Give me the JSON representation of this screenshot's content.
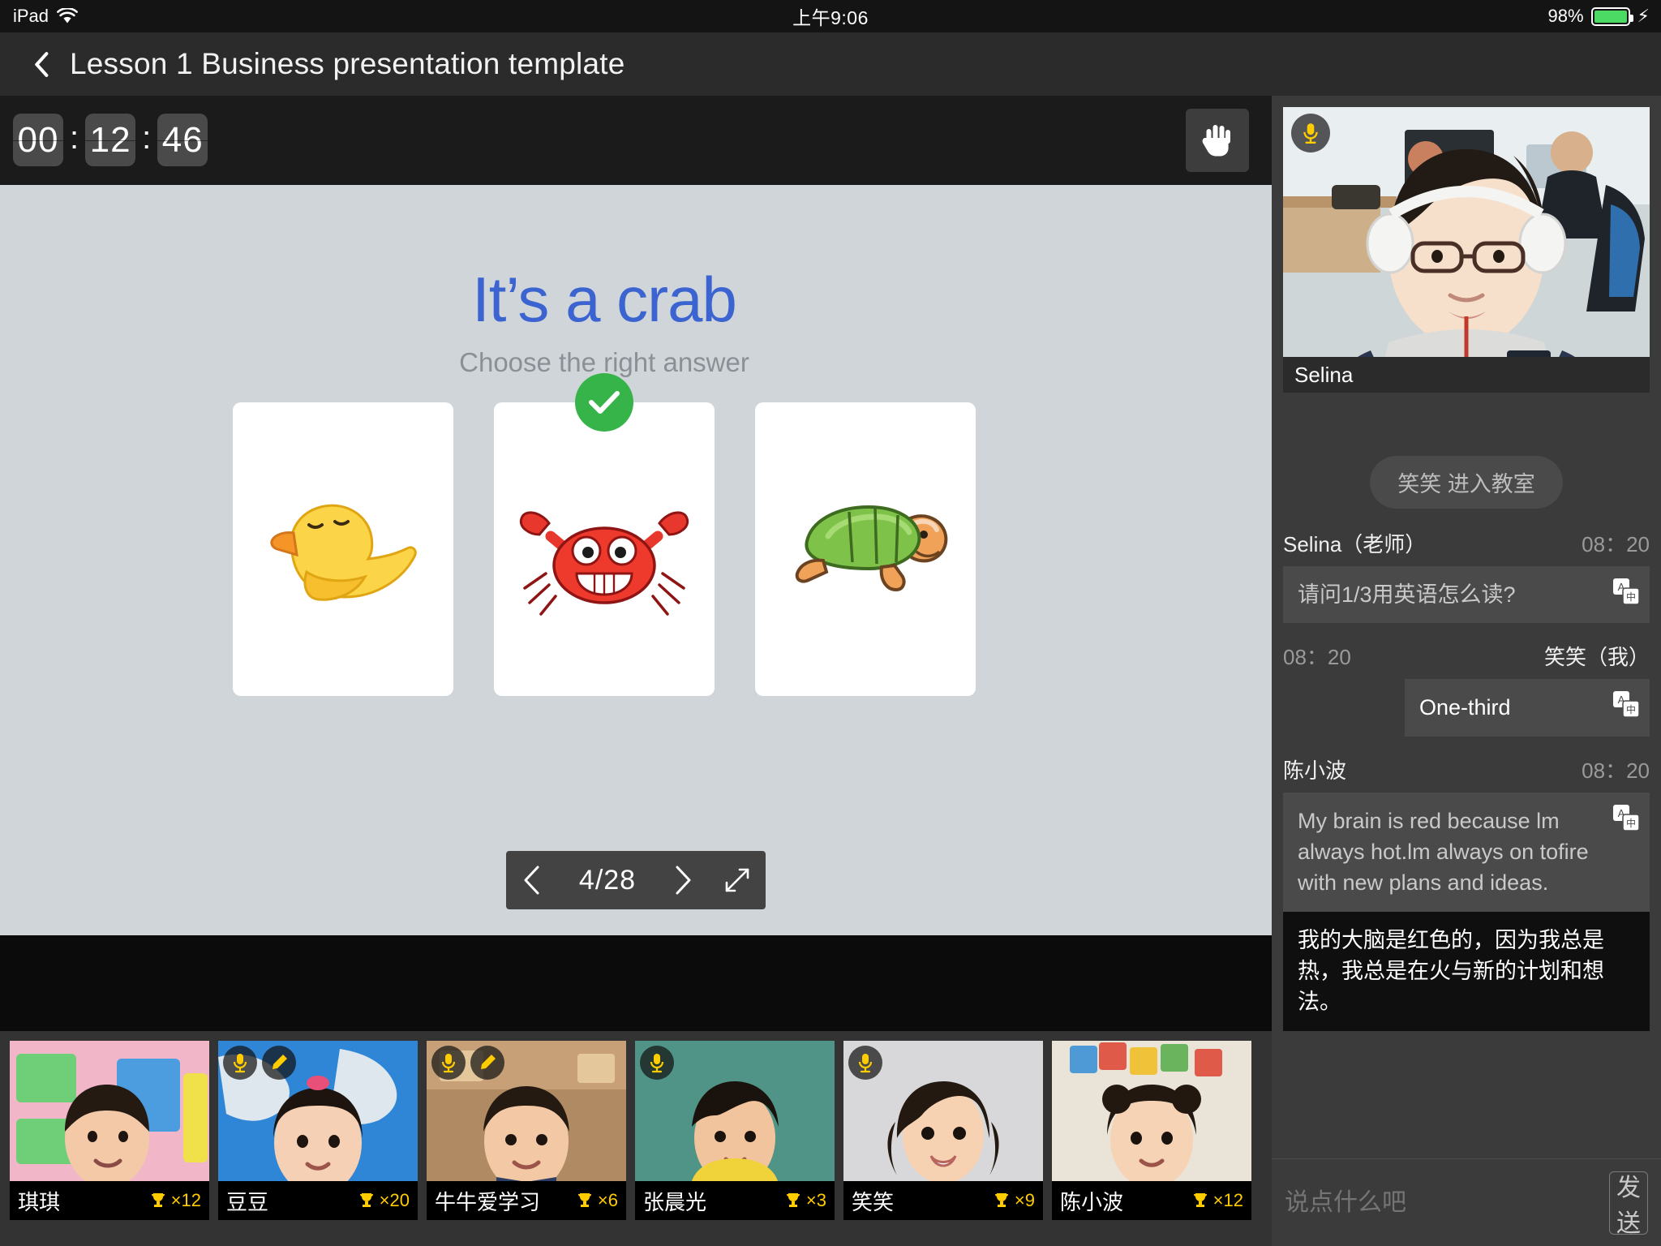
{
  "statusbar": {
    "device": "iPad",
    "wifi_icon": "wifi-icon",
    "time": "上午9:06",
    "battery_percent": "98%",
    "charging_icon": "lightning-bolt-icon"
  },
  "titlebar": {
    "back_icon": "back-chevron-icon",
    "title": "Lesson 1 Business presentation template"
  },
  "timer": {
    "hours": "00",
    "minutes": "12",
    "seconds": "46",
    "separator": ":",
    "hand_icon": "raise-hand-icon"
  },
  "slide": {
    "title": "It’s a crab",
    "subtitle": "Choose the right answer",
    "title_color": "#3c64d0",
    "answers": [
      {
        "name": "answer-card-duck",
        "icon": "duck-illustration",
        "correct": false
      },
      {
        "name": "answer-card-crab",
        "icon": "crab-illustration",
        "correct": true
      },
      {
        "name": "answer-card-turtle",
        "icon": "turtle-illustration",
        "correct": false
      }
    ],
    "correct_badge_color": "#36b449",
    "pager": {
      "prev_icon": "chevron-left-icon",
      "current": "4/28",
      "next_icon": "chevron-right-icon",
      "expand_icon": "fullscreen-expand-icon"
    }
  },
  "toolbar": {
    "accent_color": "#ff0000",
    "tools": [
      {
        "name": "cursor-target-tool",
        "icon": "target-icon",
        "has_submenu": false
      },
      {
        "name": "pencil-tool",
        "icon": "pencil-icon",
        "has_submenu": true
      },
      {
        "name": "text-tool",
        "icon": "letter-a-icon",
        "has_submenu": true
      },
      {
        "name": "rectangle-tool",
        "icon": "square-icon",
        "has_submenu": true
      },
      {
        "name": "undo-tool",
        "icon": "undo-arrow-icon",
        "has_submenu": false
      },
      {
        "name": "redo-tool",
        "icon": "redo-arrow-icon",
        "has_submenu": false
      },
      {
        "name": "eraser-tool",
        "icon": "eraser-icon",
        "has_submenu": false
      },
      {
        "name": "delete-tool",
        "icon": "trash-icon",
        "has_submenu": false
      },
      {
        "name": "color-swatch-tool",
        "icon": "color-swatch-icon",
        "has_submenu": true
      }
    ]
  },
  "teacher": {
    "name": "Selina",
    "mic_icon": "microphone-icon"
  },
  "chat": {
    "system_note": "笑笑 进入教室",
    "messages": [
      {
        "sender": "Selina（老师）",
        "time": "08：20",
        "side": "left",
        "text": "请问1/3用英语怎么读?",
        "translate_icon": "translate-icon",
        "translation": null
      },
      {
        "sender": "笑笑（我）",
        "time": "08：20",
        "side": "right",
        "text": "One-third",
        "translate_icon": "translate-icon",
        "translation": null
      },
      {
        "sender": "陈小波",
        "time": "08：20",
        "side": "left",
        "text": "My brain is red because lm always hot.lm always on tofire with new plans and ideas.",
        "translate_icon": "translate-icon",
        "translation": "我的大脑是红色的，因为我总是热，我总是在火与新的计划和想法。"
      }
    ],
    "composer": {
      "placeholder": "说点什么吧",
      "value": "",
      "send_label": "发送"
    }
  },
  "students": [
    {
      "name": "琪琪",
      "trophy": "×12",
      "badges": []
    },
    {
      "name": "豆豆",
      "trophy": "×20",
      "badges": [
        "microphone-icon",
        "pencil-icon"
      ]
    },
    {
      "name": "牛牛爱学习",
      "trophy": "×6",
      "badges": [
        "microphone-icon",
        "pencil-icon"
      ]
    },
    {
      "name": "张晨光",
      "trophy": "×3",
      "badges": [
        "microphone-icon"
      ]
    },
    {
      "name": "笑笑",
      "trophy": "×9",
      "badges": [
        "microphone-icon"
      ]
    },
    {
      "name": "陈小波",
      "trophy": "×12",
      "badges": []
    }
  ],
  "trophy_icon": "trophy-icon",
  "trophy_color": "#ffcc00"
}
